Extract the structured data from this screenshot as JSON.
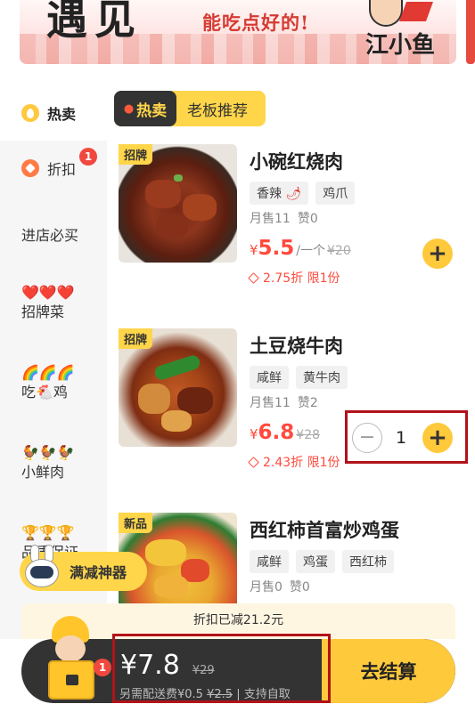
{
  "banner": {
    "headline": "遇见",
    "slogan": "能吃点好的!",
    "brand": "江小鱼"
  },
  "sidebar": {
    "items": [
      {
        "label": "热卖",
        "icon": "hot-icon"
      },
      {
        "label": "折扣",
        "icon": "discount-tag-icon",
        "badge": "1"
      },
      {
        "label": "进店必买"
      },
      {
        "label": "招牌菜",
        "emoji": "❤️❤️❤️"
      },
      {
        "label": "吃🐔鸡",
        "emoji": "🌈🌈🌈"
      },
      {
        "label": "小鲜肉",
        "emoji": "🐓🐓🐓"
      },
      {
        "label": "品质保证",
        "emoji": "🏆🏆🏆"
      }
    ]
  },
  "tabs": {
    "hot": "热卖",
    "boss": "老板推荐"
  },
  "products": [
    {
      "tag": "招牌",
      "name": "小碗红烧肉",
      "chips": [
        "香辣",
        "鸡爪"
      ],
      "sales": "月售11",
      "likes": "赞0",
      "currency": "¥",
      "price": "5.5",
      "unit": "/一个",
      "original": "¥20",
      "discount": "2.75折 限1份"
    },
    {
      "tag": "招牌",
      "name": "土豆烧牛肉",
      "chips": [
        "咸鲜",
        "黄牛肉"
      ],
      "sales": "月售11",
      "likes": "赞2",
      "currency": "¥",
      "price": "6.8",
      "unit": "",
      "original": "¥28",
      "discount": "2.43折 限1份",
      "quantity": "1"
    },
    {
      "tag": "新品",
      "name": "西红柿首富炒鸡蛋",
      "chips": [
        "咸鲜",
        "鸡蛋",
        "西红柿"
      ],
      "sales": "月售0",
      "likes": "赞0"
    }
  ],
  "promo": {
    "label": "满减神器"
  },
  "discount_strip": "折扣已减21.2元",
  "cart": {
    "badge": "1",
    "total": "¥7.8",
    "original": "¥29",
    "delivery_prefix": "另需配送费¥0.5",
    "delivery_strike": "¥2.5",
    "delivery_suffix": "| 支持自取",
    "checkout": "去结算"
  },
  "colors": {
    "accent_yellow": "#FFC93C",
    "price_red": "#FF4A3D",
    "dark_bar": "#333333",
    "highlight_box": "#B1121A"
  }
}
